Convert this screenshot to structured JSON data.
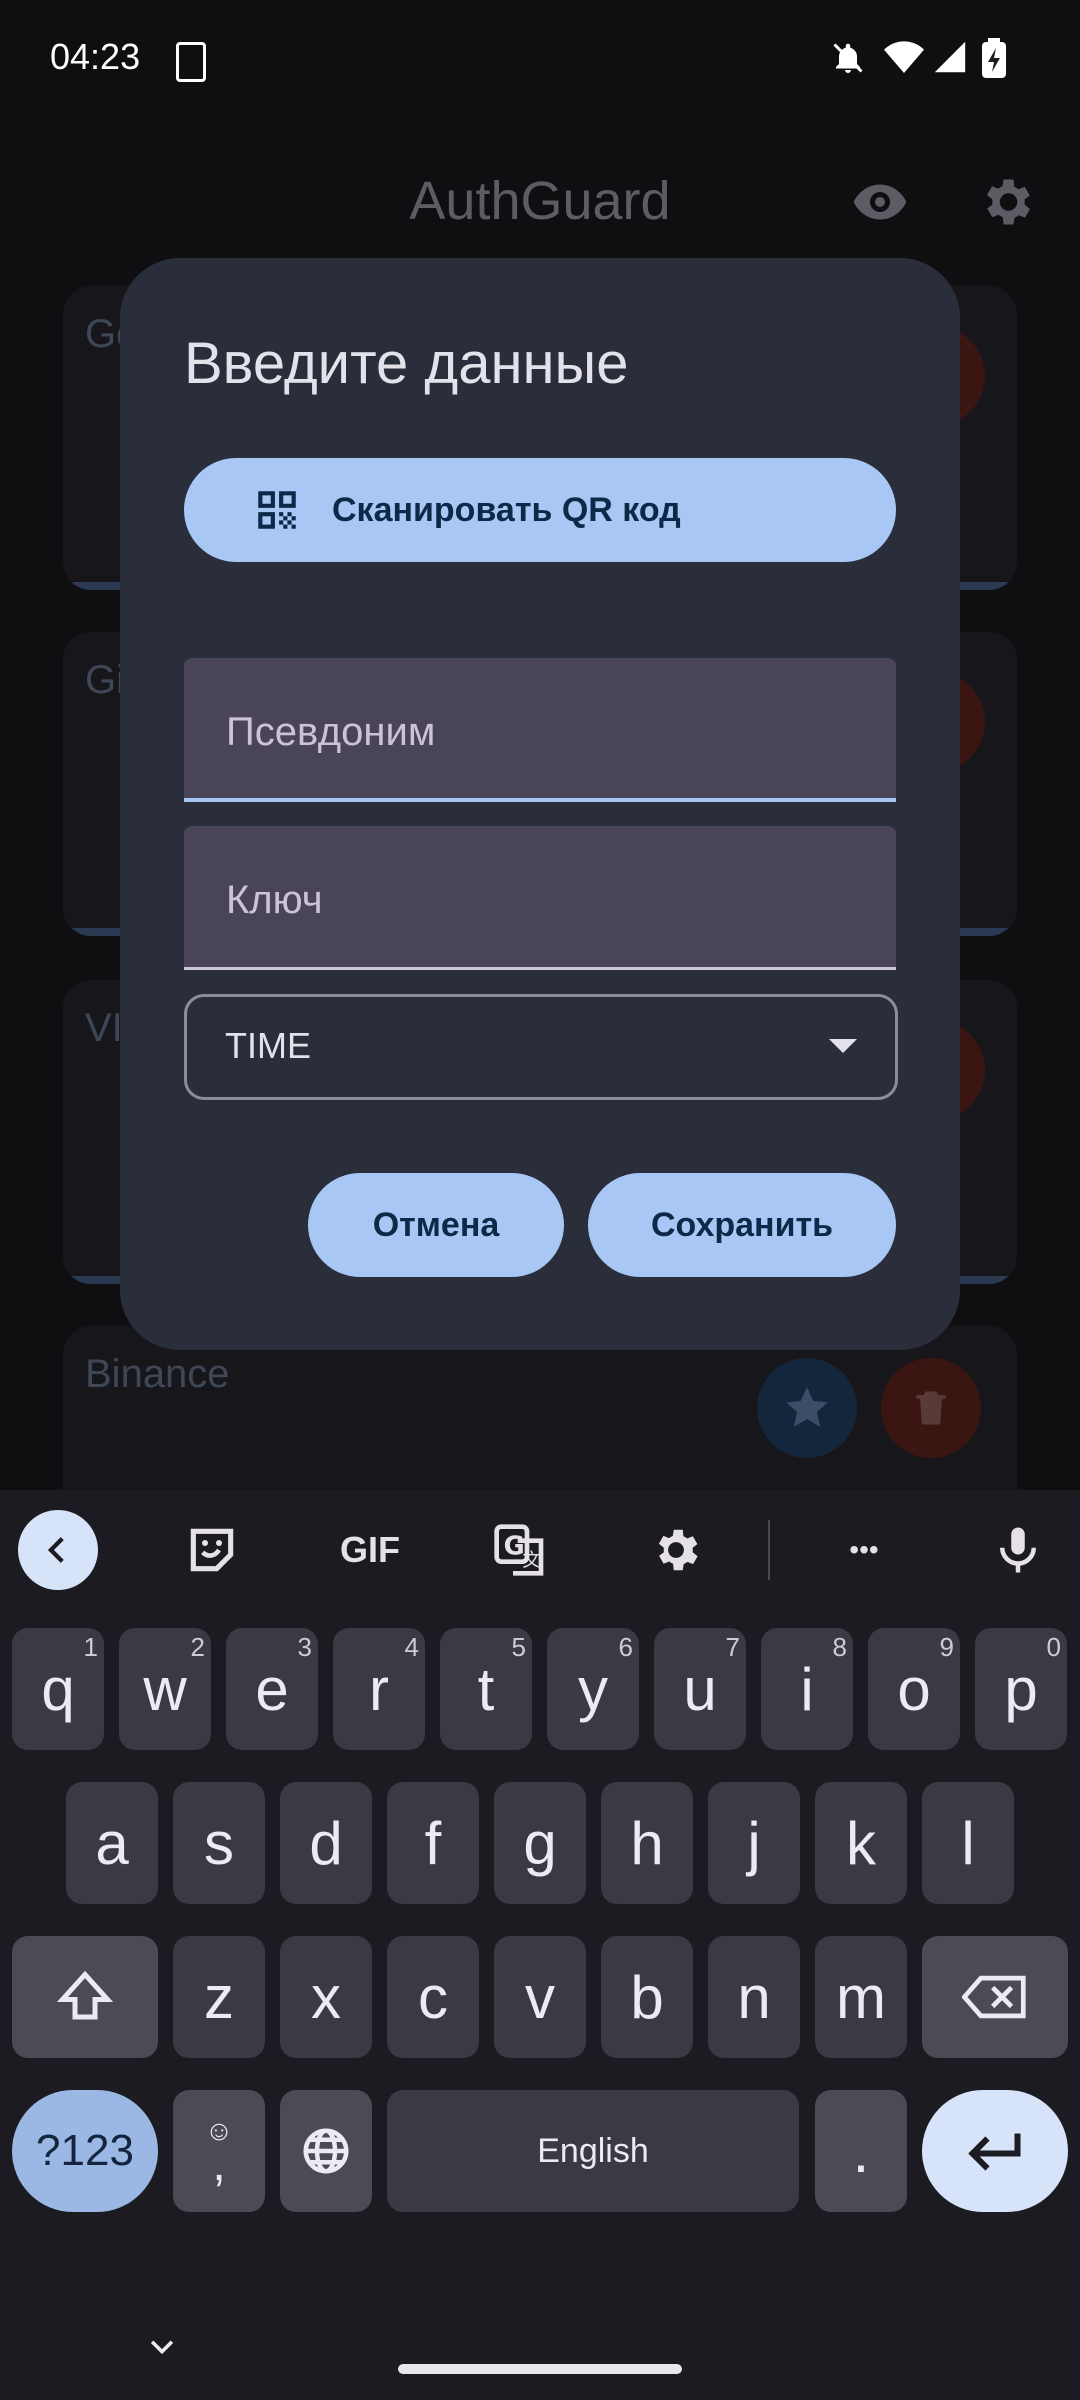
{
  "status_bar": {
    "time": "04:23"
  },
  "app": {
    "title": "AuthGuard",
    "accounts": [
      {
        "name": "Go"
      },
      {
        "name": "Gi"
      },
      {
        "name": "VI"
      },
      {
        "name": "Binance"
      }
    ]
  },
  "dialog": {
    "title": "Введите данные",
    "scan_button": "Сканировать QR код",
    "alias_placeholder": "Псевдоним",
    "key_placeholder": "Ключ",
    "type_value": "TIME",
    "cancel_button": "Отмена",
    "save_button": "Сохранить"
  },
  "keyboard": {
    "toolbar": {
      "gif": "GIF",
      "more": "•••"
    },
    "row1": [
      {
        "k": "q",
        "h": "1"
      },
      {
        "k": "w",
        "h": "2"
      },
      {
        "k": "e",
        "h": "3"
      },
      {
        "k": "r",
        "h": "4"
      },
      {
        "k": "t",
        "h": "5"
      },
      {
        "k": "y",
        "h": "6"
      },
      {
        "k": "u",
        "h": "7"
      },
      {
        "k": "i",
        "h": "8"
      },
      {
        "k": "o",
        "h": "9"
      },
      {
        "k": "p",
        "h": "0"
      }
    ],
    "row2": [
      "a",
      "s",
      "d",
      "f",
      "g",
      "h",
      "j",
      "k",
      "l"
    ],
    "row3": [
      "z",
      "x",
      "c",
      "v",
      "b",
      "n",
      "m"
    ],
    "symbols_key": "?123",
    "comma_key": ",",
    "space_label": "English",
    "period_key": "."
  },
  "colors": {
    "accent": "#a8c7f5",
    "dialog_bg": "#2a2d3a",
    "field_bg": "#4a4459"
  }
}
